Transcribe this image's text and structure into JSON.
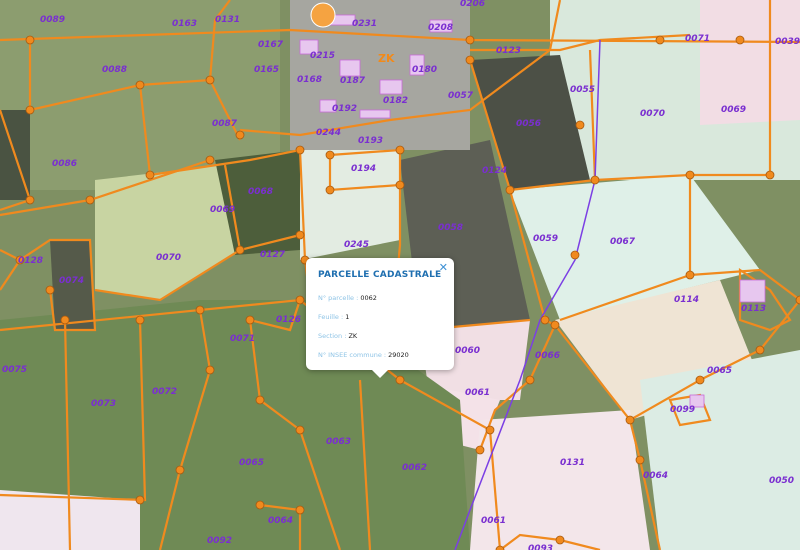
{
  "map": {
    "section_marker": "ZK",
    "parcels": [
      "0089",
      "0163",
      "0131",
      "0231",
      "0208",
      "0206",
      "0167",
      "0215",
      "0180",
      "0123",
      "0071",
      "0039",
      "0088",
      "0165",
      "0168",
      "0187",
      "0182",
      "0057",
      "0055",
      "0070",
      "0069",
      "0087",
      "0192",
      "0056",
      "0086",
      "0244",
      "0193",
      "0194",
      "0124",
      "0068",
      "0069",
      "0058",
      "0059",
      "0067",
      "0245",
      "0070",
      "0127",
      "0128",
      "0074",
      "0114",
      "0113",
      "0126",
      "0071",
      "0060",
      "0066",
      "0075",
      "0072",
      "0061",
      "0065",
      "0073",
      "0099",
      "0063",
      "0131",
      "0065",
      "0062",
      "0064",
      "0050",
      "0064",
      "0061",
      "0092",
      "0093"
    ]
  },
  "popup": {
    "title": "PARCELLE CADASTRALE",
    "close_icon": "close-icon",
    "fields": [
      {
        "label": "N° parcelle : ",
        "value": "0062"
      },
      {
        "label": "Feuille : ",
        "value": "1"
      },
      {
        "label": "Section : ",
        "value": "ZK"
      },
      {
        "label": "N° INSEE commune : ",
        "value": "29020"
      }
    ]
  },
  "colors": {
    "parcel_border": "#f08a1e",
    "label": "#7a2fd0",
    "popup_title": "#1f6fb0"
  }
}
